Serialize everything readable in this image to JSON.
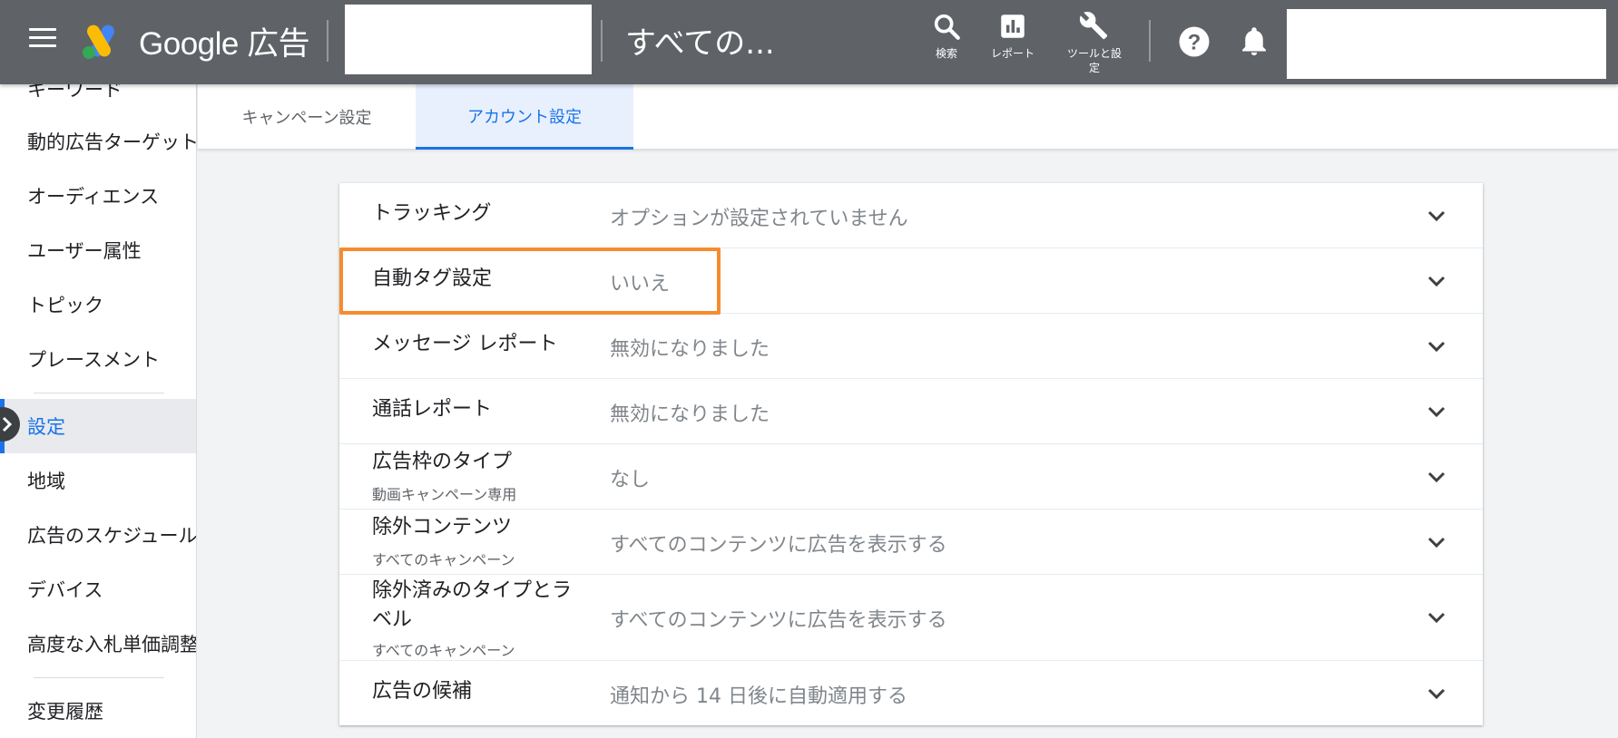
{
  "header": {
    "logo_text": "Google 広告",
    "scope_title": "すべての...",
    "tools": [
      {
        "label": "検索",
        "icon": "search-icon"
      },
      {
        "label": "レポート",
        "icon": "bar-chart-icon"
      },
      {
        "label": "ツールと設定",
        "icon": "wrench-icon"
      }
    ],
    "help_icon": "help-icon",
    "notification_icon": "bell-icon"
  },
  "sidebar": {
    "items": [
      {
        "label": "キーワード"
      },
      {
        "label": "動的広告ターゲット"
      },
      {
        "label": "オーディエンス"
      },
      {
        "label": "ユーザー属性"
      },
      {
        "label": "トピック"
      },
      {
        "label": "プレースメント"
      },
      {
        "label": "設定",
        "active": true
      },
      {
        "label": "地域"
      },
      {
        "label": "広告のスケジュール"
      },
      {
        "label": "デバイス"
      },
      {
        "label": "高度な入札単価調整"
      },
      {
        "label": "変更履歴"
      }
    ]
  },
  "tabs": [
    {
      "label": "キャンペーン設定",
      "selected": false
    },
    {
      "label": "アカウント設定",
      "selected": true
    }
  ],
  "settings": {
    "rows": [
      {
        "label": "トラッキング",
        "sublabel": "",
        "value": "オプションが設定されていません"
      },
      {
        "label": "自動タグ設定",
        "sublabel": "",
        "value": "いいえ"
      },
      {
        "label": "メッセージ レポート",
        "sublabel": "",
        "value": "無効になりました"
      },
      {
        "label": "通話レポート",
        "sublabel": "",
        "value": "無効になりました"
      },
      {
        "label": "広告枠のタイプ",
        "sublabel": "動画キャンペーン専用",
        "value": "なし"
      },
      {
        "label": "除外コンテンツ",
        "sublabel": "すべてのキャンペーン",
        "value": "すべてのコンテンツに広告を表示する"
      },
      {
        "label": "除外済みのタイプとラベル",
        "sublabel": "すべてのキャンペーン",
        "value": "すべてのコンテンツに広告を表示する"
      },
      {
        "label": "広告の候補",
        "sublabel": "",
        "value": "通知から 14 日後に自動適用する"
      }
    ]
  },
  "colors": {
    "topbar": "#5f6368",
    "accent": "#1a73e8",
    "highlight": "#f68b2f"
  }
}
